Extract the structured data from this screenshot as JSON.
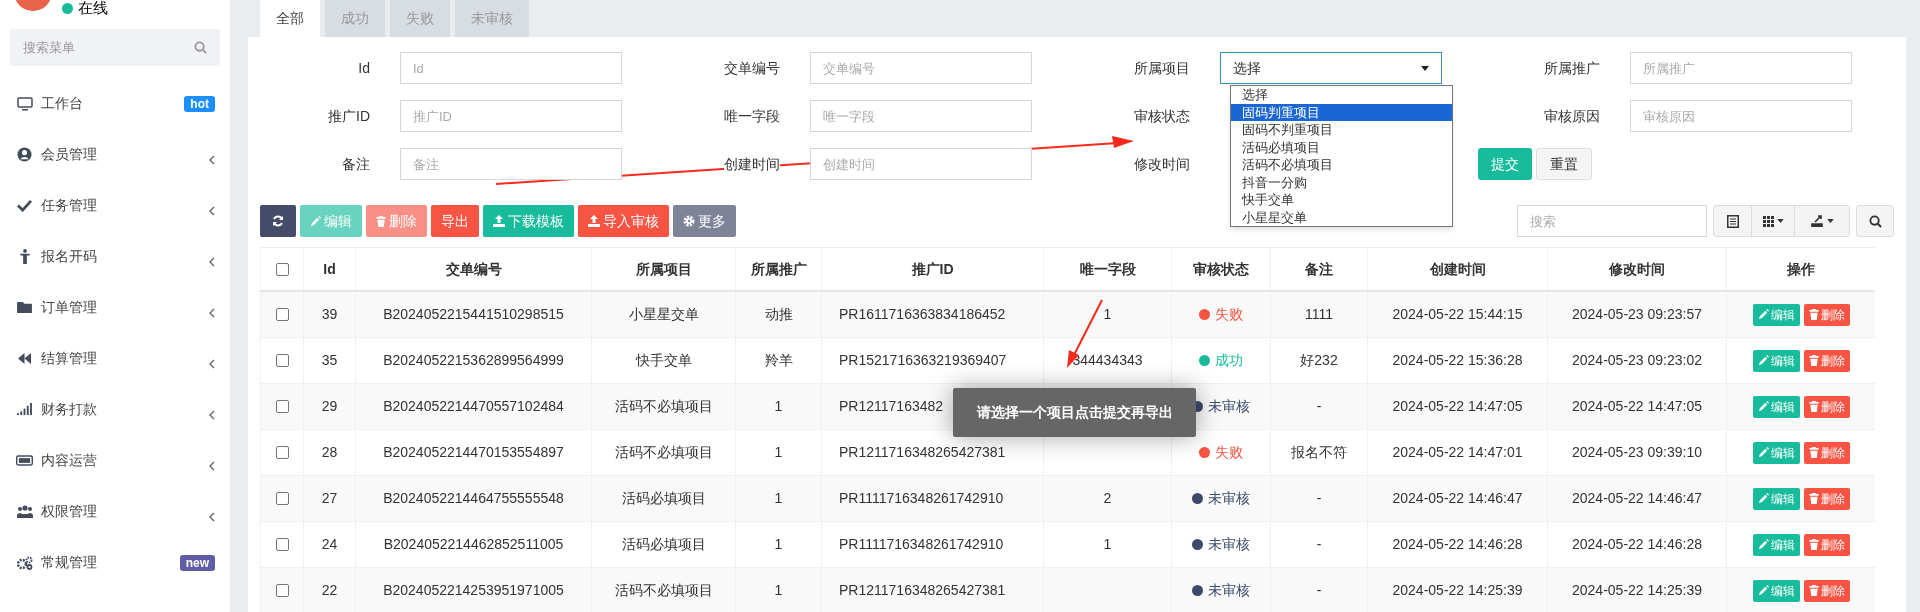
{
  "sidebar": {
    "status": "在线",
    "search_placeholder": "搜索菜单",
    "items": [
      {
        "label": "工作台",
        "expandable": false,
        "badge": {
          "text": "hot",
          "color": "#1e8fff"
        }
      },
      {
        "label": "会员管理",
        "expandable": true
      },
      {
        "label": "任务管理",
        "expandable": true
      },
      {
        "label": "报名开码",
        "expandable": true
      },
      {
        "label": "订单管理",
        "expandable": true
      },
      {
        "label": "结算管理",
        "expandable": true
      },
      {
        "label": "财务打款",
        "expandable": true
      },
      {
        "label": "内容运营",
        "expandable": true
      },
      {
        "label": "权限管理",
        "expandable": true
      },
      {
        "label": "常规管理",
        "expandable": false,
        "badge": {
          "text": "new",
          "color": "#605ca8"
        }
      }
    ]
  },
  "tabs": [
    {
      "label": "全部",
      "selected": true
    },
    {
      "label": "成功",
      "selected": false
    },
    {
      "label": "失败",
      "selected": false
    },
    {
      "label": "未审核",
      "selected": false
    }
  ],
  "filters": [
    [
      {
        "label": "Id",
        "kind": "input",
        "placeholder": "Id"
      },
      {
        "label": "交单编号",
        "kind": "input",
        "placeholder": "交单编号"
      },
      {
        "label": "所属项目",
        "kind": "select",
        "value": "选择"
      },
      {
        "label": "所属推广",
        "kind": "input",
        "placeholder": "所属推广"
      }
    ],
    [
      {
        "label": "推广ID",
        "kind": "input",
        "placeholder": "推广ID"
      },
      {
        "label": "唯一字段",
        "kind": "input",
        "placeholder": "唯一字段"
      },
      {
        "label": "审核状态",
        "kind": "covered"
      },
      {
        "label": "审核原因",
        "kind": "input",
        "placeholder": "审核原因"
      }
    ],
    [
      {
        "label": "备注",
        "kind": "input",
        "placeholder": "备注"
      },
      {
        "label": "创建时间",
        "kind": "input",
        "placeholder": "创建时间"
      },
      {
        "label": "修改时间",
        "kind": "covered"
      },
      {
        "kind": "buttons"
      }
    ]
  ],
  "form_buttons": [
    {
      "label": "提交",
      "kind": "submit"
    },
    {
      "label": "重置",
      "kind": "reset"
    }
  ],
  "dropdown": {
    "options": [
      {
        "label": "选择",
        "selected": false
      },
      {
        "label": "固码判重项目",
        "selected": true
      },
      {
        "label": "固码不判重项目",
        "selected": false
      },
      {
        "label": "活码必填项目",
        "selected": false
      },
      {
        "label": "活码不必填项目",
        "selected": false
      },
      {
        "label": "抖音一分购",
        "selected": false
      },
      {
        "label": "快手交单",
        "selected": false
      },
      {
        "label": "小星星交单",
        "selected": false
      }
    ]
  },
  "toolbar": [
    {
      "kind": "refresh",
      "disabled": false
    },
    {
      "kind": "edit",
      "label": "编辑",
      "disabled": true
    },
    {
      "kind": "delete",
      "label": "删除",
      "disabled": true
    },
    {
      "kind": "export",
      "label": "导出",
      "disabled": false
    },
    {
      "kind": "download",
      "label": "下载模板",
      "disabled": false
    },
    {
      "kind": "import",
      "label": "导入审核",
      "disabled": false
    },
    {
      "kind": "more",
      "label": "更多",
      "disabled": false
    }
  ],
  "table_search": {
    "placeholder": "搜索"
  },
  "table": {
    "select_all": {
      "checked": false
    },
    "columns": [
      "Id",
      "交单编号",
      "所属项目",
      "所属推广",
      "推广ID",
      "唯一字段",
      "审核状态",
      "备注",
      "创建时间",
      "修改时间",
      "操作"
    ],
    "rows": [
      {
        "checked": false,
        "id": "39",
        "order_no": "B2024052215441510298515",
        "project": "小星星交单",
        "promoter": "动推",
        "promo_id": "PR1611716363834186452",
        "unique": "1",
        "status": {
          "label": "失败",
          "color": "#f75444"
        },
        "note": "1111",
        "created": "2024-05-22 15:44:15",
        "modified": "2024-05-23 09:23:57",
        "actions": [
          "编辑",
          "删除"
        ]
      },
      {
        "checked": false,
        "id": "35",
        "order_no": "B2024052215362899564999",
        "project": "快手交单",
        "promoter": "羚羊",
        "promo_id": "PR1521716363219369407",
        "unique": "344434343",
        "status": {
          "label": "成功",
          "color": "#18bc9c"
        },
        "note": "好232",
        "created": "2024-05-22 15:36:28",
        "modified": "2024-05-23 09:23:02",
        "actions": [
          "编辑",
          "删除"
        ]
      },
      {
        "checked": false,
        "id": "29",
        "order_no": "B2024052214470557102484",
        "project": "活码不必填项目",
        "promoter": "1",
        "promo_id": "PR12117163482",
        "status": {
          "label": "未审核",
          "color": "#3d4a6b"
        },
        "note": "-",
        "created": "2024-05-22 14:47:05",
        "modified": "2024-05-22 14:47:05",
        "actions": [
          "编辑",
          "删除"
        ]
      },
      {
        "checked": false,
        "id": "28",
        "order_no": "B2024052214470153554897",
        "project": "活码不必填项目",
        "promoter": "1",
        "promo_id": "PR1211716348265427381",
        "status": {
          "label": "失败",
          "color": "#f75444"
        },
        "note": "报名不符",
        "created": "2024-05-22 14:47:01",
        "modified": "2024-05-23 09:39:10",
        "actions": [
          "编辑",
          "删除"
        ]
      },
      {
        "checked": false,
        "id": "27",
        "order_no": "B2024052214464755555548",
        "project": "活码必填项目",
        "promoter": "1",
        "promo_id": "PR1111716348261742910",
        "unique": "2",
        "status": {
          "label": "未审核",
          "color": "#3d4a6b"
        },
        "note": "-",
        "created": "2024-05-22 14:46:47",
        "modified": "2024-05-22 14:46:47",
        "actions": [
          "编辑",
          "删除"
        ]
      },
      {
        "checked": false,
        "id": "24",
        "order_no": "B2024052214462852511005",
        "project": "活码必填项目",
        "promoter": "1",
        "promo_id": "PR1111716348261742910",
        "unique": "1",
        "status": {
          "label": "未审核",
          "color": "#3d4a6b"
        },
        "note": "-",
        "created": "2024-05-22 14:46:28",
        "modified": "2024-05-22 14:46:28",
        "actions": [
          "编辑",
          "删除"
        ]
      },
      {
        "checked": false,
        "id": "22",
        "order_no": "B2024052214253951971005",
        "project": "活码不必填项目",
        "promoter": "1",
        "promo_id": "PR1211716348265427381",
        "status": {
          "label": "未审核",
          "color": "#3d4a6b"
        },
        "note": "-",
        "created": "2024-05-22 14:25:39",
        "modified": "2024-05-22 14:25:39",
        "actions": [
          "编辑",
          "删除"
        ]
      }
    ]
  },
  "toast": "请选择一个项目点击提交再导出"
}
